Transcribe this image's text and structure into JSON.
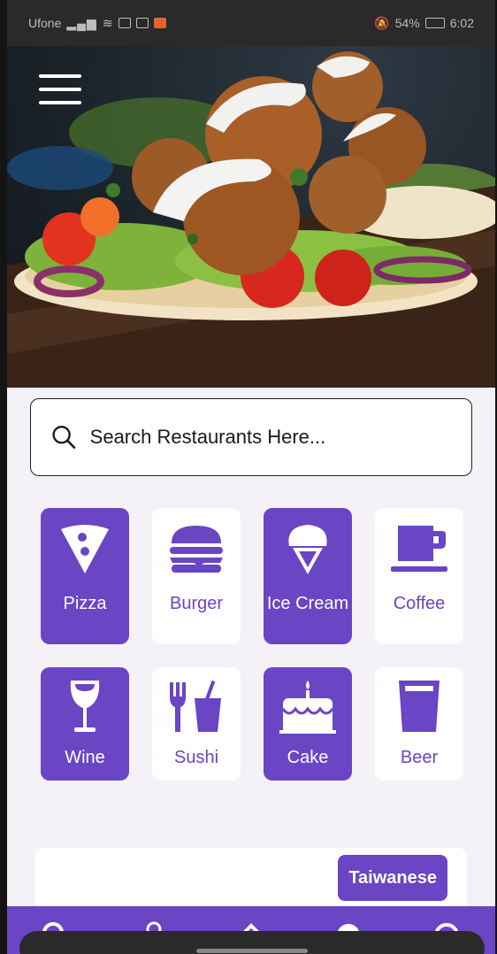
{
  "status_bar": {
    "carrier": "Ufone",
    "battery": "54%",
    "time": "6:02"
  },
  "hero": {
    "image_subject": "falafel wrap with salad",
    "menu_icon": "hamburger-menu-icon"
  },
  "search": {
    "placeholder": "Search Restaurants Here...",
    "icon": "search-icon"
  },
  "categories": [
    {
      "label": "Pizza",
      "icon": "pizza-icon",
      "active": true
    },
    {
      "label": "Burger",
      "icon": "burger-icon",
      "active": false
    },
    {
      "label": "Ice Cream",
      "icon": "ice-cream-icon",
      "active": true
    },
    {
      "label": "Coffee",
      "icon": "coffee-icon",
      "active": false
    },
    {
      "label": "Wine",
      "icon": "wine-icon",
      "active": true
    },
    {
      "label": "Sushi",
      "icon": "sushi-icon",
      "active": false
    },
    {
      "label": "Cake",
      "icon": "cake-icon",
      "active": true
    },
    {
      "label": "Beer",
      "icon": "beer-icon",
      "active": false
    }
  ],
  "restaurant_card": {
    "cuisine_tag": "Taiwanese"
  },
  "bottom_nav": [
    {
      "icon": "search-icon"
    },
    {
      "icon": "profile-icon"
    },
    {
      "icon": "home-icon"
    },
    {
      "icon": "info-icon"
    },
    {
      "icon": "history-icon"
    }
  ],
  "colors": {
    "accent": "#6a45c4",
    "background": "#f4f1f7",
    "card": "#ffffff"
  }
}
